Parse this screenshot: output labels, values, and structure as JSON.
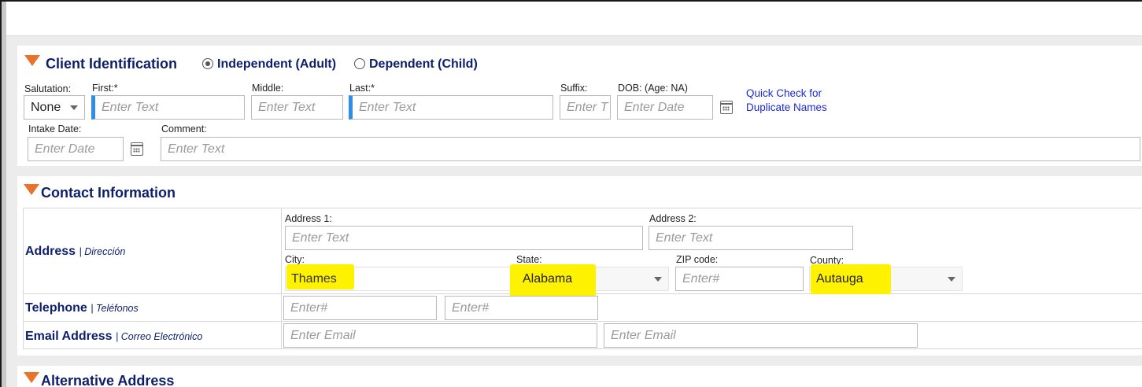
{
  "client_identification": {
    "title": "Client Identification",
    "radio_independent": "Independent (Adult)",
    "radio_dependent": "Dependent (Child)",
    "salutation_label": "Salutation:",
    "salutation_value": "None",
    "first_label": "First:*",
    "first_placeholder": "Enter Text",
    "middle_label": "Middle:",
    "middle_placeholder": "Enter Text",
    "last_label": "Last:*",
    "last_placeholder": "Enter Text",
    "suffix_label": "Suffix:",
    "suffix_placeholder": "Enter T",
    "dob_label": "DOB: (Age: NA)",
    "dob_placeholder": "Enter Date",
    "quick_check_line1": "Quick Check for",
    "quick_check_line2": "Duplicate Names",
    "intake_label": "Intake Date:",
    "intake_placeholder": "Enter Date",
    "comment_label": "Comment:",
    "comment_placeholder": "Enter Text"
  },
  "contact_information": {
    "title": "Contact Information",
    "address_label": "Address",
    "address_sub": "Dirección",
    "address1_label": "Address 1:",
    "address1_placeholder": "Enter Text",
    "address2_label": "Address 2:",
    "address2_placeholder": "Enter Text",
    "city_label": "City:",
    "city_value": "Thames",
    "state_label": "State:",
    "state_value": "Alabama",
    "zip_label": "ZIP code:",
    "zip_placeholder": "Enter#",
    "county_label": "County:",
    "county_value": "Autauga",
    "telephone_label": "Telephone",
    "telephone_sub": "Teléfonos",
    "phone1_placeholder": "Enter#",
    "phone2_placeholder": "Enter#",
    "email_label": "Email Address",
    "email_sub": "Correo Electrónico",
    "email1_placeholder": "Enter Email",
    "email2_placeholder": "Enter Email"
  },
  "alternative_address": {
    "title": "Alternative Address"
  },
  "colors": {
    "heading_navy": "#0d1f6b",
    "accent_orange": "#e8732a",
    "required_blue": "#2f8dea",
    "link_blue": "#1a2bd1",
    "highlight_yellow": "#fff200"
  }
}
